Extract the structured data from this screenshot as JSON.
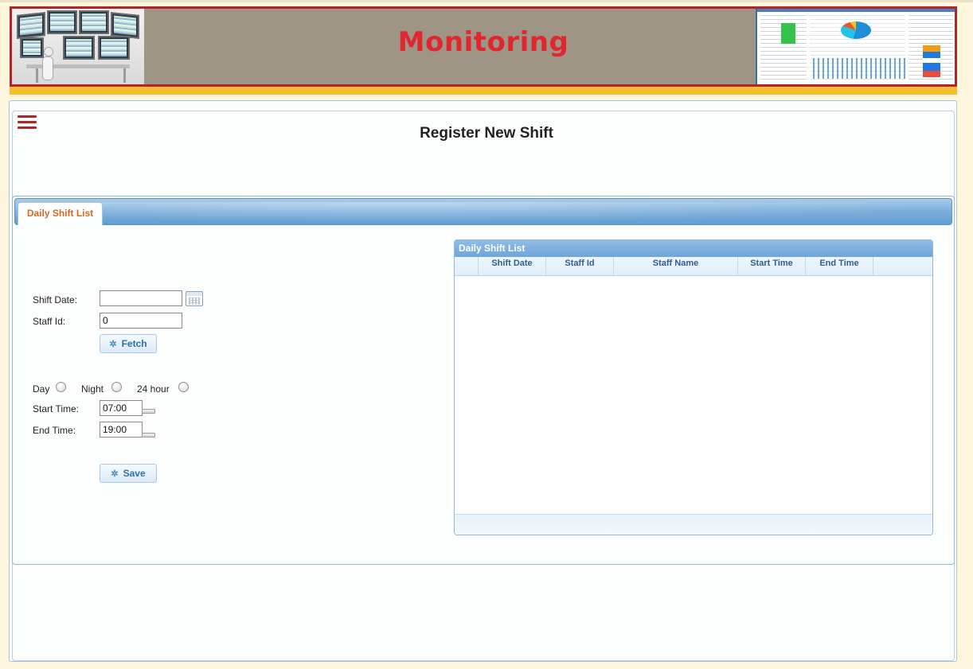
{
  "banner": {
    "title": "Monitoring"
  },
  "page": {
    "title": "Register New Shift"
  },
  "tabs": [
    {
      "label": "Daily Shift List",
      "active": true
    }
  ],
  "form": {
    "shift_date": {
      "label": "Shift Date:",
      "value": ""
    },
    "staff_id": {
      "label": "Staff Id:",
      "value": "0"
    },
    "fetch_button": {
      "label": "Fetch",
      "icon": "gear-icon"
    },
    "shift_options": [
      {
        "label": "Day",
        "selected": false
      },
      {
        "label": "Night",
        "selected": false
      },
      {
        "label": "24 hour",
        "selected": false
      }
    ],
    "start_time": {
      "label": "Start Time:",
      "value": "07:00"
    },
    "end_time": {
      "label": "End Time:",
      "value": "19:00"
    },
    "save_button": {
      "label": "Save",
      "icon": "gear-icon"
    }
  },
  "grid": {
    "caption": "Daily Shift List",
    "columns": [
      "",
      "Shift Date",
      "Staff Id",
      "Staff Name",
      "Start Time",
      "End Time"
    ],
    "rows": []
  },
  "colors": {
    "accent_red": "#b3232b",
    "title_red": "#e0262f",
    "stripe_yellow": "#f3bf2e",
    "tab_text_orange": "#d26a23",
    "header_blue": "#6ea5d8"
  }
}
